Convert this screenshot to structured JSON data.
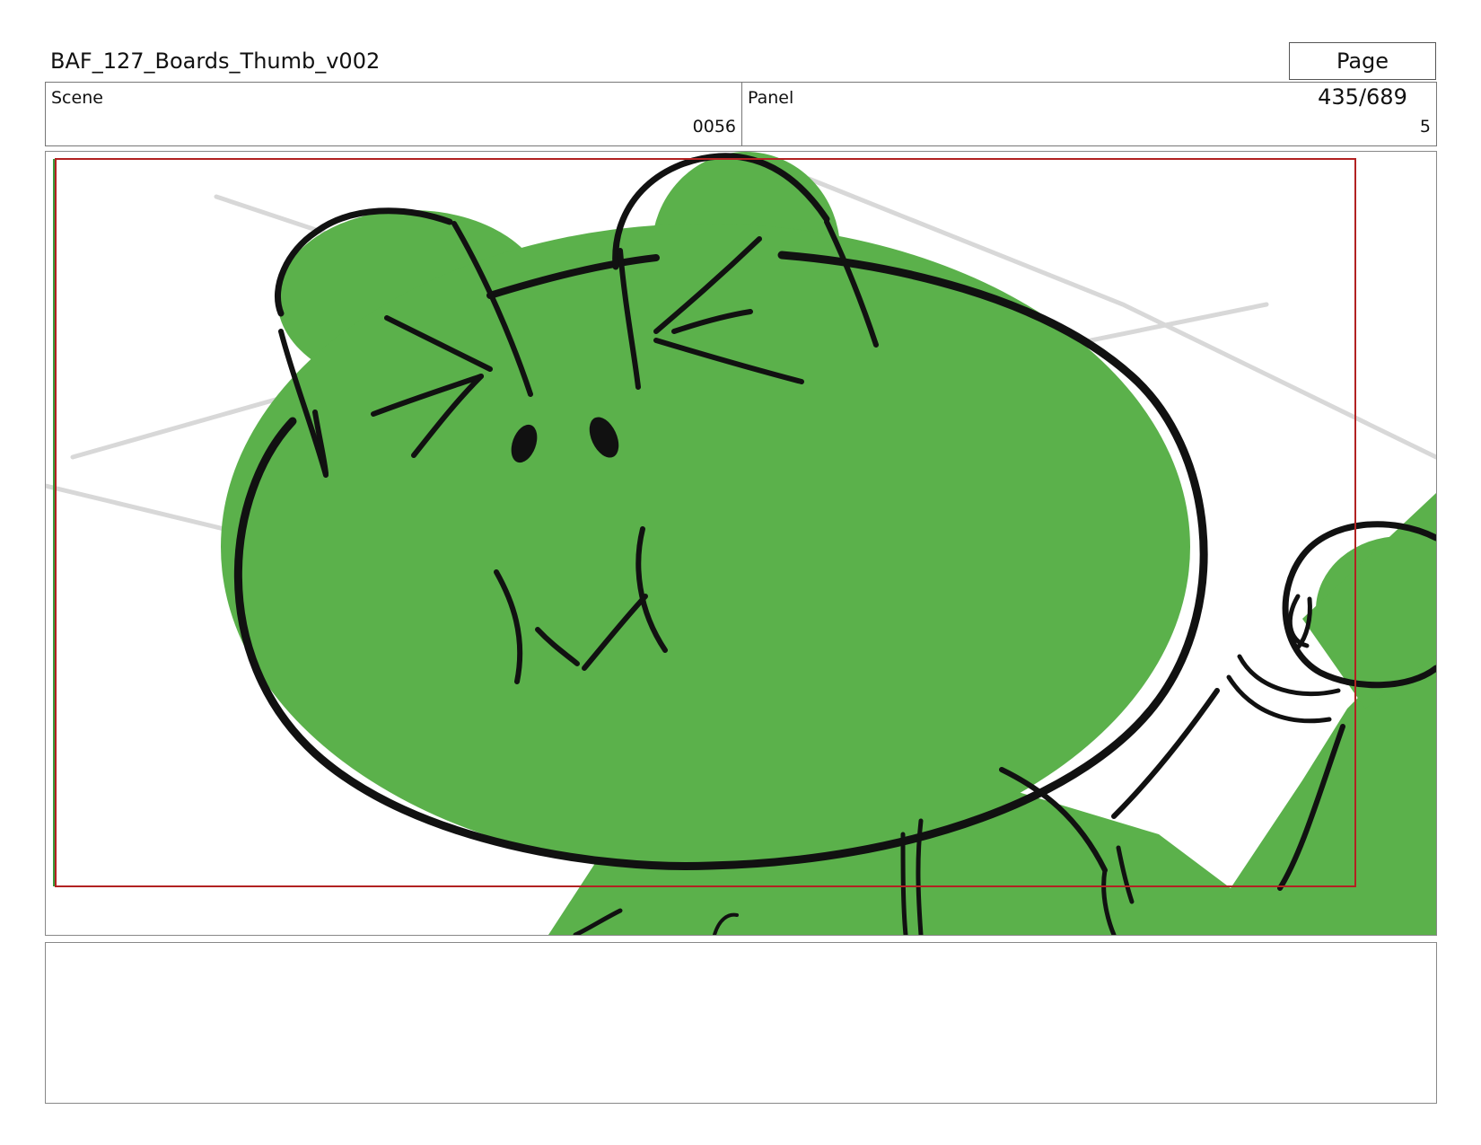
{
  "document": {
    "title": "BAF_127_Boards_Thumb_v002",
    "page_label": "Page 435/689"
  },
  "scene": {
    "label": "Scene",
    "value": "0056"
  },
  "panel": {
    "label": "Panel",
    "value": "5"
  },
  "drawing": {
    "subject": "frog-character-sketch",
    "fill_color": "#5bb14b",
    "line_color": "#111111",
    "safe_frame_color": "#b22222"
  },
  "notes": {
    "text": ""
  }
}
